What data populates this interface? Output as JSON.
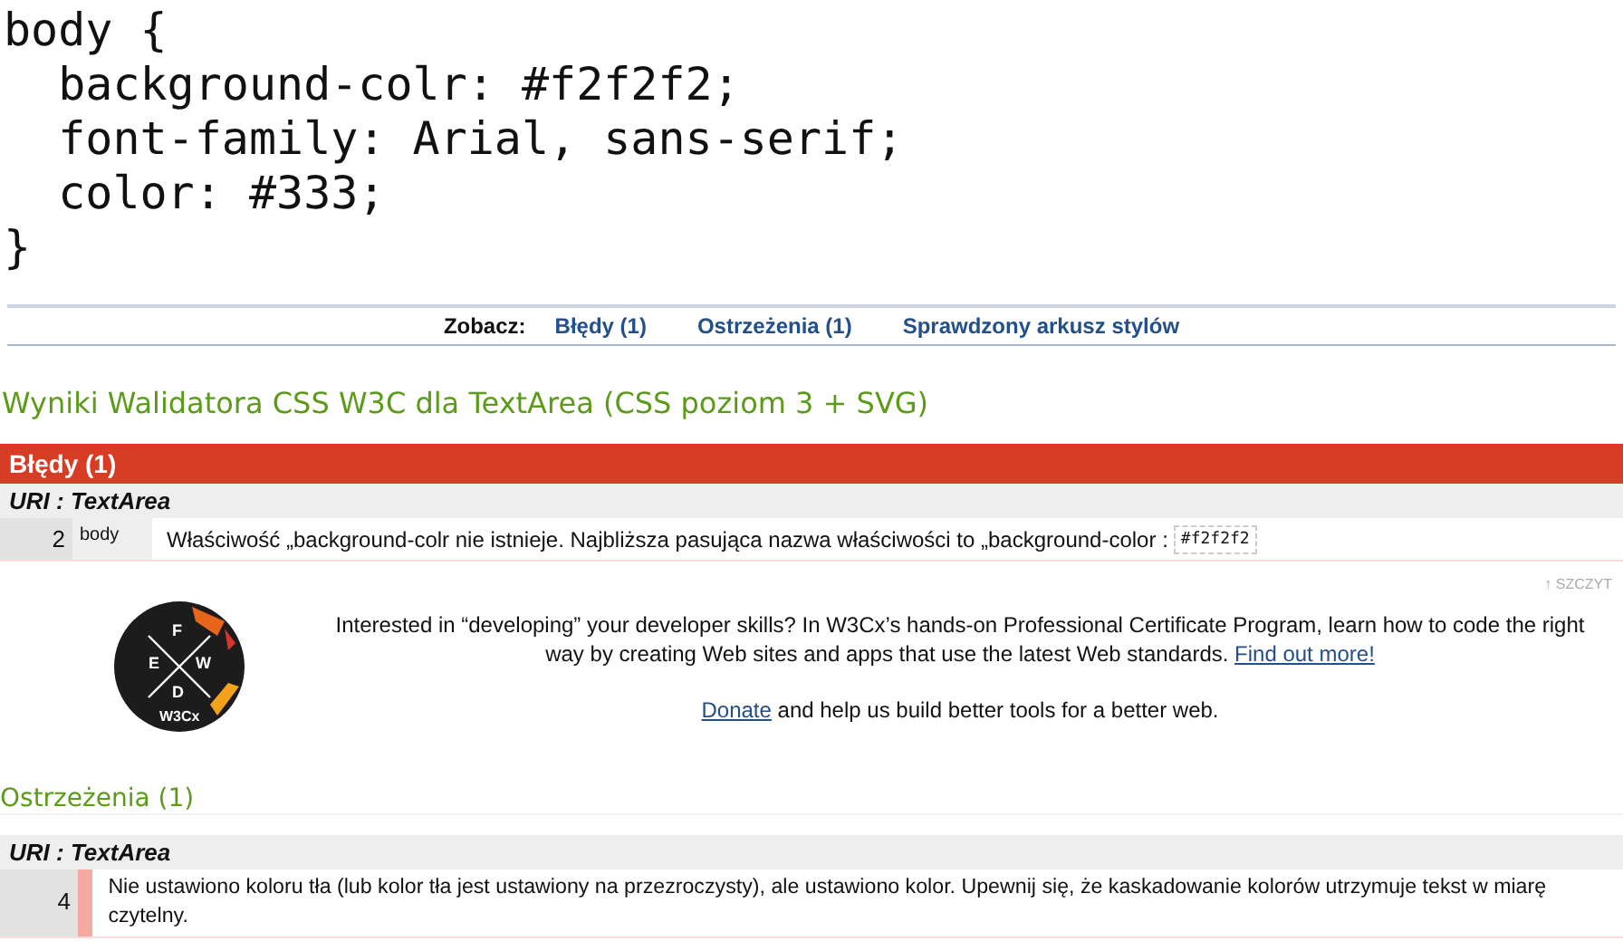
{
  "code_lines": [
    "body {",
    "  background-colr: #f2f2f2;",
    "  font-family: Arial, sans-serif;",
    "  color: #333;",
    "}"
  ],
  "nav": {
    "label": "Zobacz:",
    "links": [
      {
        "text": "Błędy (1)"
      },
      {
        "text": "Ostrzeżenia (1)"
      },
      {
        "text": "Sprawdzony arkusz stylów"
      }
    ]
  },
  "title": "Wyniki Walidatora CSS W3C dla TextArea (CSS poziom 3 + SVG)",
  "errors": {
    "heading": "Błędy (1)",
    "uri": "URI : TextArea",
    "rows": [
      {
        "line": "2",
        "context": "body",
        "message": "Właściwość „background-colr nie istnieje. Najbliższa pasująca nazwa właściwości to „background-color :",
        "code": "#f2f2f2"
      }
    ]
  },
  "top_link": "↑ SZCZYT",
  "promo": {
    "logo_letters": [
      "F",
      "E",
      "D",
      "W"
    ],
    "logo_brand": "W3Cx",
    "text": "Interested in “developing” your developer skills? In W3Cx’s hands-on Professional Certificate Program, learn how to code the right way by creating Web sites and apps that use the latest Web standards.",
    "link": "Find out more!",
    "donate_link": "Donate",
    "donate_text": "and help us build better tools for a better web."
  },
  "warnings": {
    "heading": "Ostrzeżenia (1)",
    "uri": "URI : TextArea",
    "rows": [
      {
        "line": "4",
        "message": "Nie ustawiono koloru tła (lub kolor tła jest ustawiony na przezroczysty), ale ustawiono kolor. Upewnij się, że kaskadowanie kolorów utrzymuje tekst w miarę czytelny."
      }
    ]
  }
}
